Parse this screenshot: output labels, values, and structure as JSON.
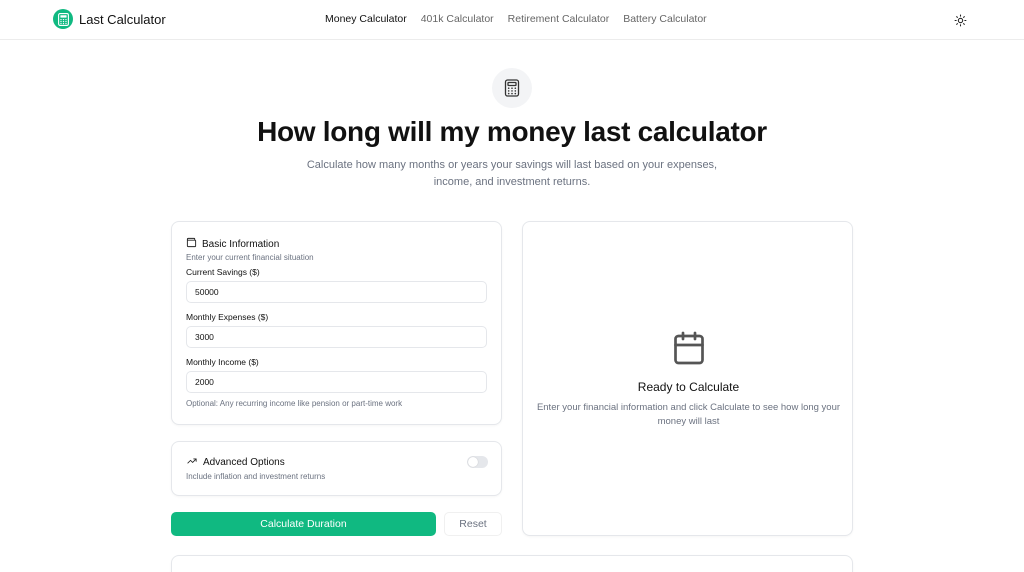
{
  "header": {
    "brand": "Last Calculator",
    "nav": [
      "Money Calculator",
      "401k Calculator",
      "Retirement Calculator",
      "Battery Calculator"
    ],
    "active_nav": "Money Calculator",
    "logo_icon": "calculator-icon",
    "theme_icon": "sun-icon"
  },
  "hero": {
    "icon": "calculator-icon",
    "title": "How long will my money last calculator",
    "subtitle": "Calculate how many months or years your savings will last based on your expenses, income, and investment returns."
  },
  "basic": {
    "icon": "wallet-icon",
    "title": "Basic Information",
    "description": "Enter your current financial situation",
    "fields": [
      {
        "label": "Current Savings ($)",
        "value": "50000"
      },
      {
        "label": "Monthly Expenses ($)",
        "value": "3000"
      },
      {
        "label": "Monthly Income ($)",
        "value": "2000"
      }
    ],
    "income_hint": "Optional: Any recurring income like pension or part-time work"
  },
  "advanced": {
    "icon": "trending-up-icon",
    "title": "Advanced Options",
    "description": "Include inflation and investment returns",
    "enabled": false
  },
  "actions": {
    "calculate": "Calculate Duration",
    "reset": "Reset"
  },
  "result": {
    "icon": "calendar-icon",
    "title": "Ready to Calculate",
    "description": "Enter your financial information and click Calculate to see how long your money will last"
  },
  "colors": {
    "accent": "#10b981",
    "text": "#111111",
    "muted": "#6b7280",
    "border": "#e5e7eb"
  }
}
